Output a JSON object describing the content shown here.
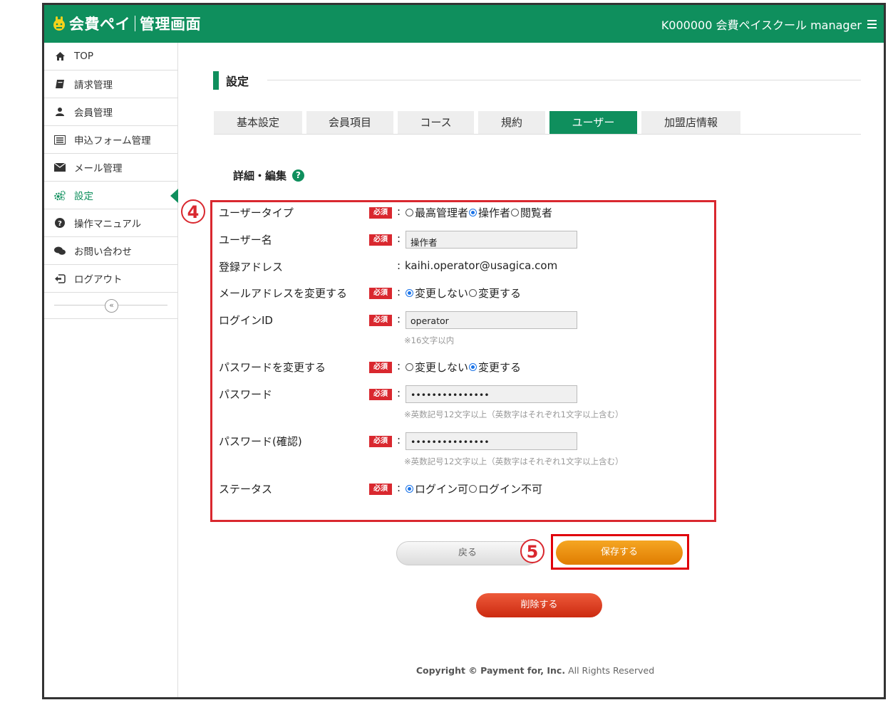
{
  "header": {
    "logo_text": "会費ペイ",
    "logo_sub": "管理画面",
    "account": "K000000 会費ペイスクール manager"
  },
  "sidebar": {
    "items": [
      {
        "label": "TOP",
        "icon": "home-icon"
      },
      {
        "label": "請求管理",
        "icon": "book-icon"
      },
      {
        "label": "会員管理",
        "icon": "user-icon"
      },
      {
        "label": "申込フォーム管理",
        "icon": "form-icon"
      },
      {
        "label": "メール管理",
        "icon": "mail-icon"
      },
      {
        "label": "設定",
        "icon": "gears-icon",
        "active": true
      },
      {
        "label": "操作マニュアル",
        "icon": "question-icon"
      },
      {
        "label": "お問い合わせ",
        "icon": "chat-icon"
      },
      {
        "label": "ログアウト",
        "icon": "logout-icon"
      }
    ],
    "collapse_glyph": "«"
  },
  "page": {
    "title": "設定",
    "tabs": [
      {
        "label": "基本設定"
      },
      {
        "label": "会員項目"
      },
      {
        "label": "コース"
      },
      {
        "label": "規約"
      },
      {
        "label": "ユーザー",
        "active": true
      },
      {
        "label": "加盟店情報"
      }
    ],
    "section_title": "詳細・編集",
    "help_glyph": "?"
  },
  "annotations": {
    "step4": "4",
    "step5": "5"
  },
  "form": {
    "required_badge": "必須",
    "colon": ":",
    "user_type": {
      "label": "ユーザータイプ",
      "options": [
        "最高管理者",
        "操作者",
        "閲覧者"
      ],
      "selected": "操作者"
    },
    "user_name": {
      "label": "ユーザー名",
      "value": "操作者"
    },
    "email": {
      "label": "登録アドレス",
      "value": "kaihi.operator@usagica.com"
    },
    "change_email": {
      "label": "メールアドレスを変更する",
      "options": [
        "変更しない",
        "変更する"
      ],
      "selected": "変更しない"
    },
    "login_id": {
      "label": "ログインID",
      "value": "operator",
      "hint": "※16文字以内"
    },
    "change_password": {
      "label": "パスワードを変更する",
      "options": [
        "変更しない",
        "変更する"
      ],
      "selected": "変更する"
    },
    "password": {
      "label": "パスワード",
      "value": "•••••••••••••••",
      "hint": "※英数記号12文字以上（英数字はそれぞれ1文字以上含む）"
    },
    "password_confirm": {
      "label": "パスワード(確認)",
      "value": "•••••••••••••••",
      "hint": "※英数記号12文字以上（英数字はそれぞれ1文字以上含む）"
    },
    "status": {
      "label": "ステータス",
      "options": [
        "ログイン可",
        "ログイン不可"
      ],
      "selected": "ログイン可"
    }
  },
  "buttons": {
    "back": "戻る",
    "save": "保存する",
    "delete": "削除する"
  },
  "footer": {
    "copyright_prefix": "Copyright © Payment for, Inc.",
    "copyright_suffix": "All Rights Reserved"
  },
  "colors": {
    "brand": "#0f8f5d",
    "required": "#d9282f",
    "save": "#f0960e",
    "delete": "#dd4024"
  }
}
